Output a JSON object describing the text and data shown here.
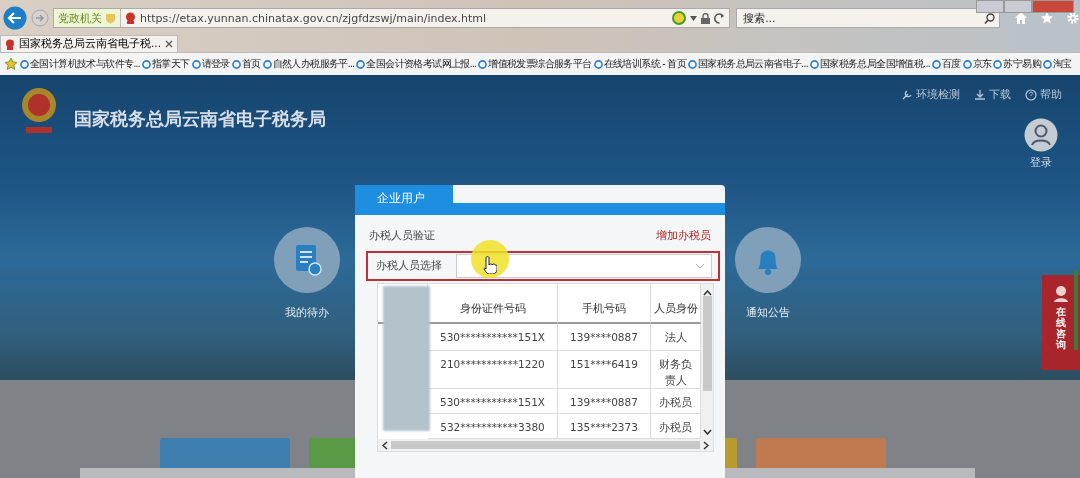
{
  "browser": {
    "address": {
      "badge": "党政机关",
      "url": "https://etax.yunnan.chinatax.gov.cn/zjgfdzswj/main/index.html"
    },
    "search": {
      "placeholder": "搜索..."
    },
    "tabs": [
      {
        "label": "国家税务总局云南省电子税...",
        "selected": true
      }
    ],
    "favorites": [
      "全国计算机技术与软件专...",
      "指掌天下",
      "请登录",
      "首页",
      "自然人办税服务平...",
      "全国会计资格考试网上报...",
      "增值税发票综合服务平台",
      "在线培训系统 - 首页",
      "国家税务总局云南省电子...",
      "国家税务总局全国增值税...",
      "百度",
      "京东",
      "苏宁易购",
      "淘宝"
    ]
  },
  "site": {
    "title": "国家税务总局云南省电子税务局",
    "links": [
      "环境检测",
      "下载",
      "帮助"
    ],
    "login": "登录",
    "quick": [
      "我的待办",
      "通知公告"
    ],
    "consult": "在线咨询",
    "tiles": [
      {
        "color": "#3f7fb0"
      },
      {
        "color": "#5a9a46"
      },
      {
        "color": "#b99a2e"
      },
      {
        "color": "#c07a50"
      }
    ]
  },
  "dialog": {
    "tab": "企业用户",
    "section": "办税人员验证",
    "add_link": "增加办税员",
    "select_label": "办税人员选择",
    "columns": [
      "身份证件号码",
      "手机号码",
      "人员身份"
    ],
    "rows": [
      [
        "530***********151X",
        "139****0887",
        "法人"
      ],
      [
        "210***********1220",
        "151****6419",
        "财务负责人"
      ],
      [
        "530***********151X",
        "139****0887",
        "办税员"
      ],
      [
        "532***********3380",
        "135****2373",
        "办税员"
      ]
    ]
  }
}
